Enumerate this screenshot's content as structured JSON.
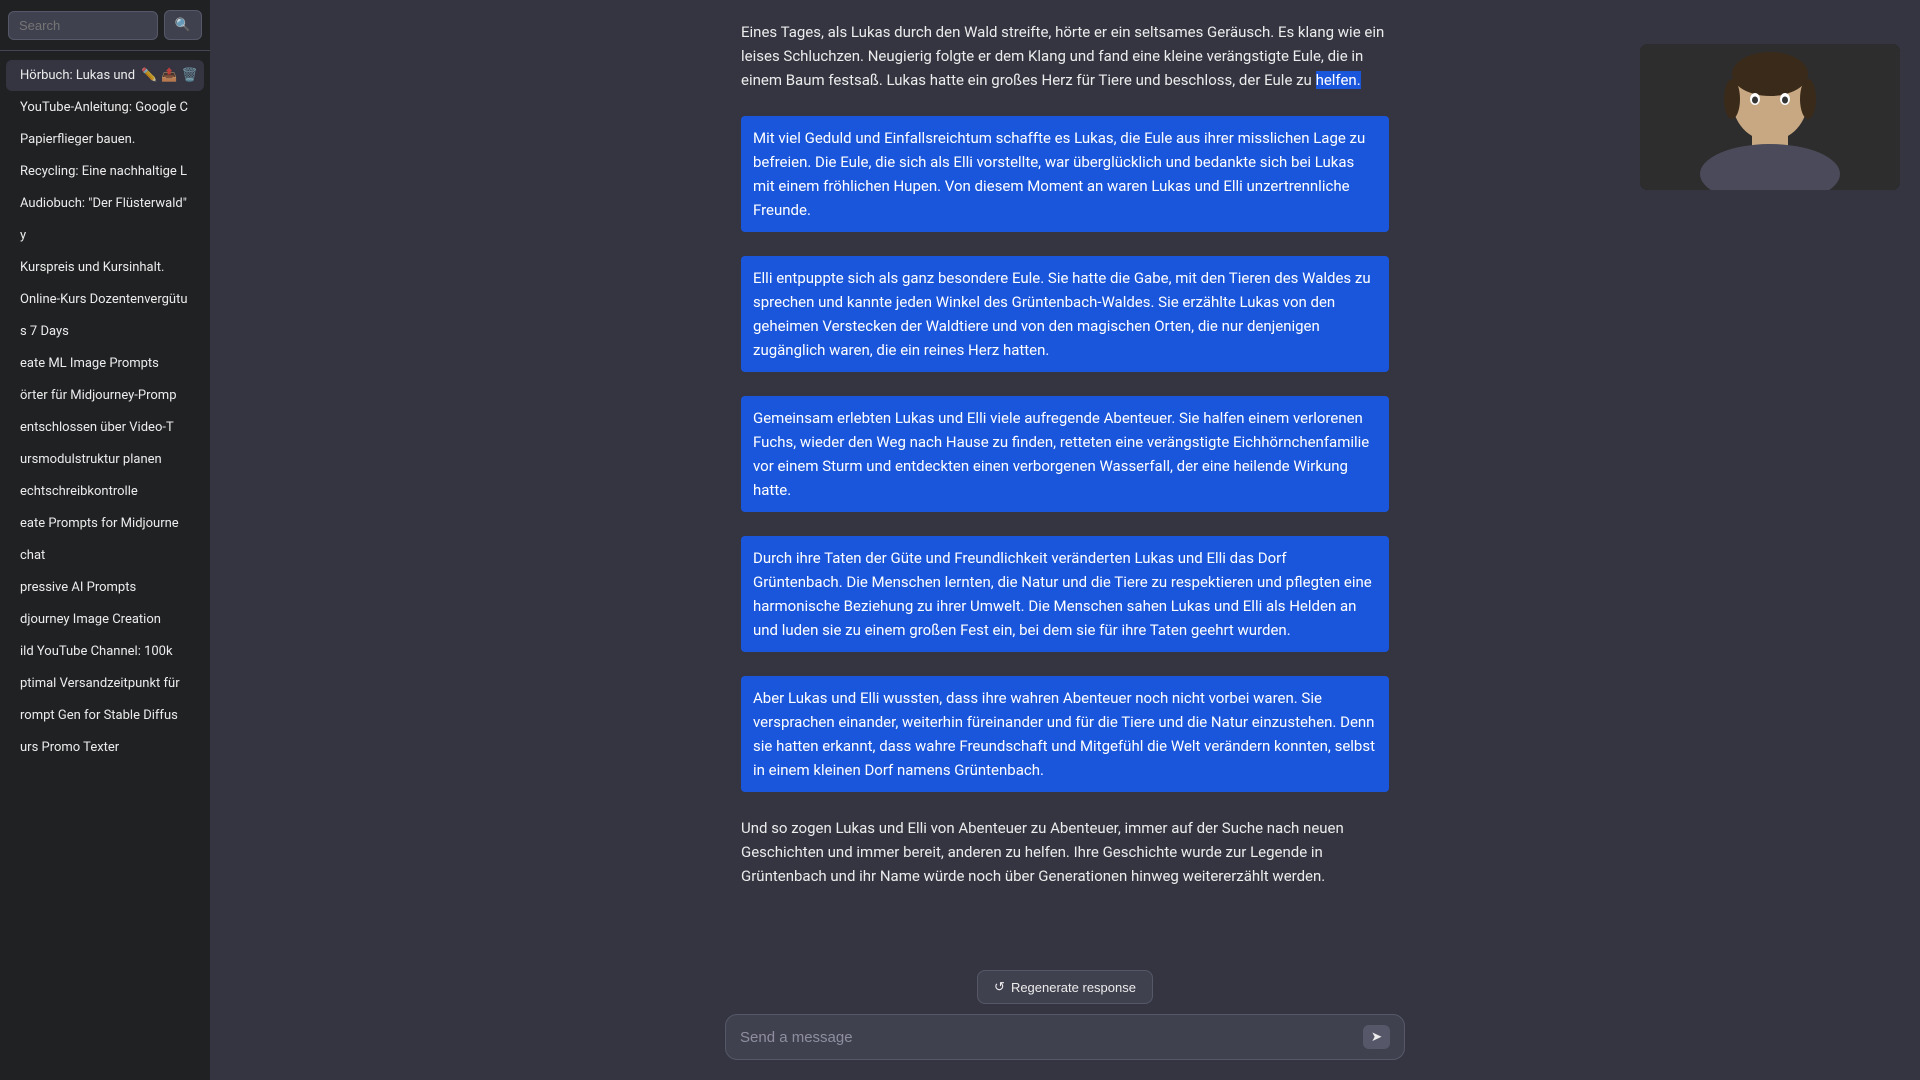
{
  "sidebar": {
    "search_placeholder": "Search",
    "search_button": "🔍",
    "active_item_title": "Hörbuch: Lukas und",
    "active_item_icons": [
      "✏️",
      "📤",
      "🗑️"
    ],
    "sections": [
      {
        "label": "",
        "items": [
          "Hörbuch: Lukas und",
          "YouTube-Anleitung: Google C",
          "Papierflieger bauen.",
          "Recycling: Eine nachhaltige L",
          "Audiobuch: \"Der Flüsterwald\"",
          "y",
          "Kurspreis und Kursinhalt.",
          "Online-Kurs Dozentenvergütu",
          "s 7 Days",
          "eate ML Image Prompts",
          "örter für Midjourney-Promp",
          "entschlossen über Video-T",
          "ursmodulstruktur planen",
          "echtschreibkontrolle",
          "eate Prompts for Midjourne",
          "ew chat",
          "pressive AI Prompts",
          "djourney Image Creation",
          "ild YouTube Channel: 100k",
          "ptimal Versandzeitpunkt für",
          "rompt Gen for Stable Diffus",
          "urs Promo Texter"
        ]
      }
    ]
  },
  "chat": {
    "label": "chat",
    "messages": [
      {
        "id": 1,
        "text": "Eines Tages, als Lukas durch den Wald streifte, hörte er ein seltsames Geräusch. Es klang wie ein leises Schluchzen. Neugierig folgte er dem Klang und fand eine kleine verängstigte Eule, die in einem Baum festsaß. Lukas hatte ein großes Herz für Tiere und beschloss, der Eule zu helfen.",
        "highlighted_end": "helfen.",
        "type": "partial"
      },
      {
        "id": 2,
        "text": "Mit viel Geduld und Einfallsreichtum schaffte es Lukas, die Eule aus ihrer misslichen Lage zu befreien. Die Eule, die sich als Elli vorstellte, war überglücklich und bedankte sich bei Lukas mit einem fröhlichen Hupen. Von diesem Moment an waren Lukas und Elli unzertrennliche Freunde.",
        "type": "full"
      },
      {
        "id": 3,
        "text": "Elli entpuppte sich als ganz besondere Eule. Sie hatte die Gabe, mit den Tieren des Waldes zu sprechen und kannte jeden Winkel des Grüntenbach-Waldes. Sie erzählte Lukas von den geheimen Verstecken der Waldtiere und von den magischen Orten, die nur denjenigen zugänglich waren, die ein reines Herz hatten.",
        "type": "full"
      },
      {
        "id": 4,
        "text": "Gemeinsam erlebten Lukas und Elli viele aufregende Abenteuer. Sie halfen einem verlorenen Fuchs, wieder den Weg nach Hause zu finden, retteten eine verängstigte Eichhörnchenfamilie vor einem Sturm und entdeckten einen verborgenen Wasserfall, der eine heilende Wirkung hatte.",
        "type": "full"
      },
      {
        "id": 5,
        "text": "Durch ihre Taten der Güte und Freundlichkeit veränderten Lukas und Elli das Dorf Grüntenbach. Die Menschen lernten, die Natur und die Tiere zu respektieren und pflegten eine harmonische Beziehung zu ihrer Umwelt. Die Menschen sahen Lukas und Elli als Helden an und luden sie zu einem großen Fest ein, bei dem sie für ihre Taten geehrt wurden.",
        "type": "full"
      },
      {
        "id": 6,
        "text": "Aber Lukas und Elli wussten, dass ihre wahren Abenteuer noch nicht vorbei waren. Sie versprachen einander, weiterhin füreinander und für die Tiere und die Natur einzustehen. Denn sie hatten erkannt, dass wahre Freundschaft und Mitgefühl die Welt verändern konnten, selbst in einem kleinen Dorf namens Grüntenbach.",
        "type": "full"
      },
      {
        "id": 7,
        "text": "Und so zogen Lukas und Elli von Abenteuer zu Abenteuer, immer auf der Suche nach neuen Geschichten und immer bereit, anderen zu helfen. Ihre Geschichte wurde zur Legende in Grüntenbach und ihr Name würde noch über Generationen hinweg weitererzählt werden.",
        "type": "last"
      }
    ],
    "regenerate_label": "Regenerate response",
    "send_placeholder": "Send a message",
    "send_icon": "➤"
  },
  "colors": {
    "highlight_bg": "#1a56db",
    "sidebar_bg": "#202123",
    "main_bg": "#343541",
    "input_bg": "#40414f"
  }
}
